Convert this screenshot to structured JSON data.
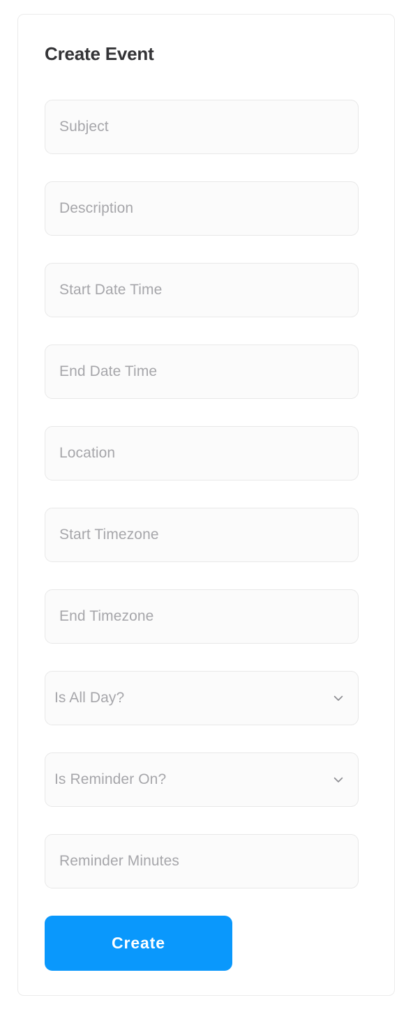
{
  "card": {
    "title": "Create Event",
    "accent_color": "#0a98fc",
    "border_color": "#ebebeb"
  },
  "form": {
    "fields": [
      {
        "name": "subject",
        "type": "text",
        "placeholder": "Subject",
        "value": ""
      },
      {
        "name": "description",
        "type": "text",
        "placeholder": "Description",
        "value": ""
      },
      {
        "name": "start-date-time",
        "type": "text",
        "placeholder": "Start Date Time",
        "value": ""
      },
      {
        "name": "end-date-time",
        "type": "text",
        "placeholder": "End Date Time",
        "value": ""
      },
      {
        "name": "location",
        "type": "text",
        "placeholder": "Location",
        "value": ""
      },
      {
        "name": "start-timezone",
        "type": "text",
        "placeholder": "Start Timezone",
        "value": ""
      },
      {
        "name": "end-timezone",
        "type": "text",
        "placeholder": "End Timezone",
        "value": ""
      },
      {
        "name": "is-all-day",
        "type": "select",
        "placeholder": "Is All Day?",
        "value": "",
        "icon": "chevron-down-icon"
      },
      {
        "name": "is-reminder-on",
        "type": "select",
        "placeholder": "Is Reminder On?",
        "value": "",
        "icon": "chevron-down-icon"
      },
      {
        "name": "reminder-minutes",
        "type": "text",
        "placeholder": "Reminder Minutes",
        "value": ""
      }
    ],
    "submit": {
      "label": "Create"
    }
  }
}
